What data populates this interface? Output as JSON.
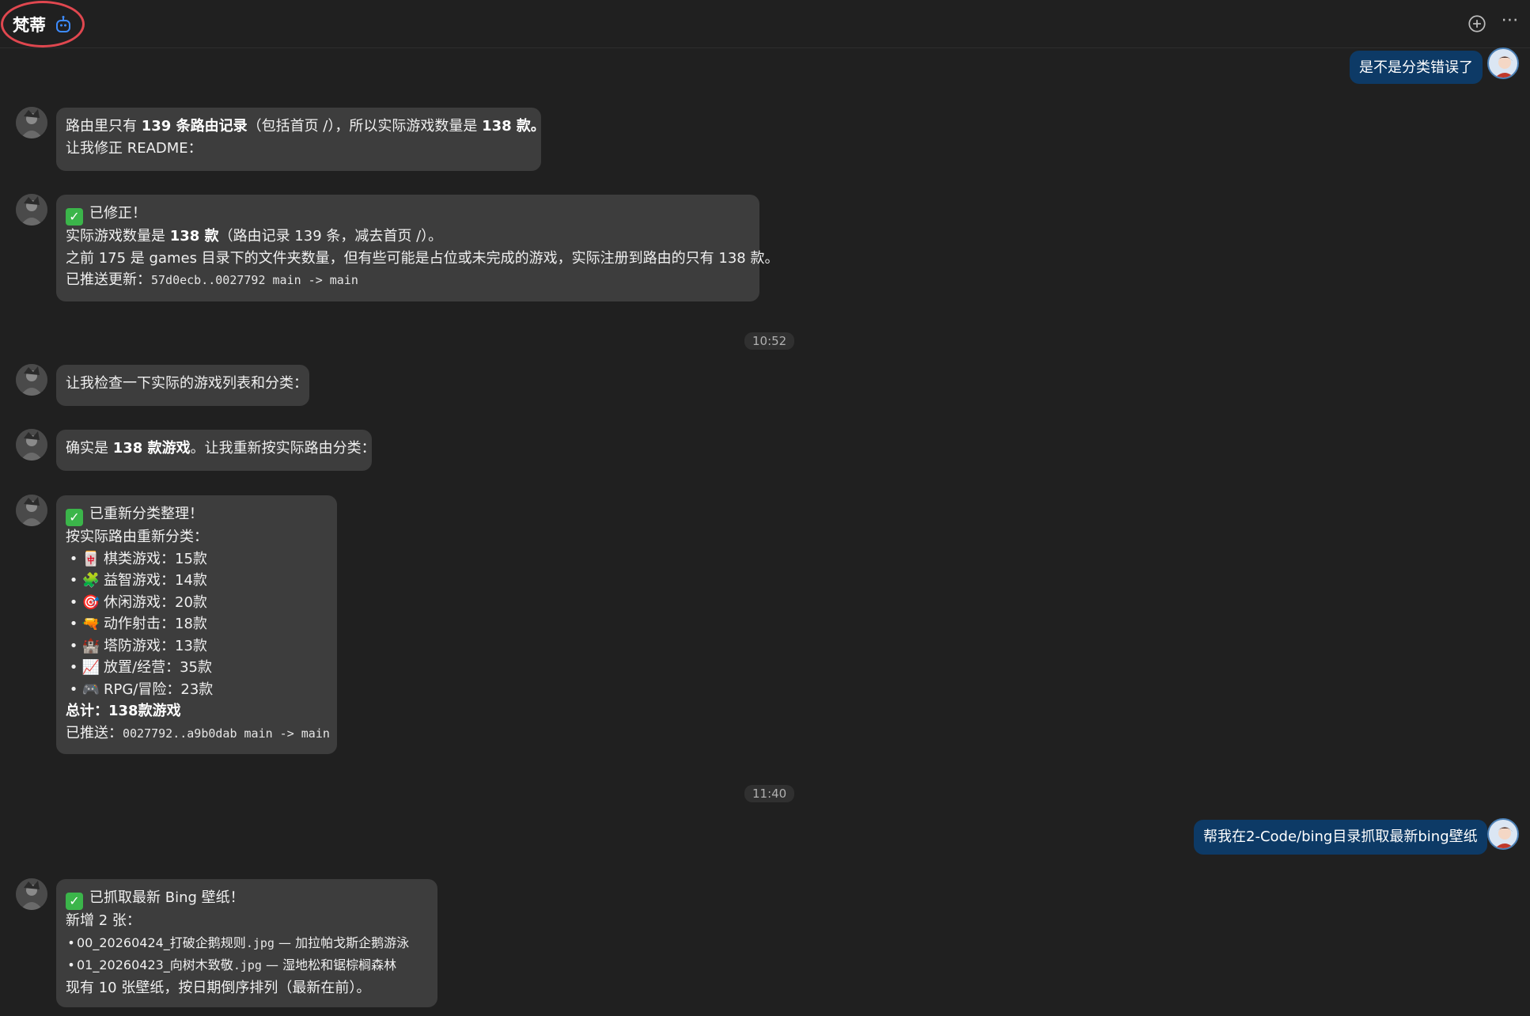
{
  "header": {
    "title": "梵蒂",
    "add_icon": "plus-circle-icon",
    "more_icon": "more-dots-icon",
    "more_label": "⋯"
  },
  "timestamps": {
    "t1": "10:52",
    "t2": "11:40"
  },
  "messages": {
    "u1": {
      "text": "是不是分类错误了"
    },
    "a1": {
      "p1": "路由里只有 ",
      "b1": "139 条路由记录",
      "p2": "（包括首页 /），所以实际游戏数量是 ",
      "b2": "138 款。",
      "line2": "让我修正 README："
    },
    "a2": {
      "title": "已修正！",
      "l2a": "实际游戏数量是 ",
      "l2b": "138 款",
      "l2c": "（路由记录 139 条，减去首页 /）。",
      "l3": "之前 175 是 games 目录下的文件夹数量，但有些可能是占位或未完成的游戏，实际注册到路由的只有 138 款。",
      "l4a": "已推送更新：",
      "l4b": "57d0ecb..0027792 main -> main"
    },
    "a3": {
      "text": "让我检查一下实际的游戏列表和分类："
    },
    "a4": {
      "p1": "确实是 ",
      "b1": "138 款游戏",
      "p2": "。让我重新按实际路由分类："
    },
    "a5": {
      "title": "已重新分类整理！",
      "line2": "按实际路由重新分类：",
      "items": [
        {
          "emoji": "🀄",
          "text": "棋类游戏：15款"
        },
        {
          "emoji": "🧩",
          "text": "益智游戏：14款"
        },
        {
          "emoji": "🎯",
          "text": "休闲游戏：20款"
        },
        {
          "emoji": "🔫",
          "text": "动作射击：18款"
        },
        {
          "emoji": "🏰",
          "text": "塔防游戏：13款"
        },
        {
          "emoji": "📈",
          "text": "放置/经营：35款"
        },
        {
          "emoji": "🎮",
          "text": "RPG/冒险：23款"
        }
      ],
      "total": "总计：138款游戏",
      "pushed_a": "已推送：",
      "pushed_b": "0027792..a9b0dab main -> main"
    },
    "u2": {
      "text": "帮我在2-Code/bing目录抓取最新bing壁纸"
    },
    "a6": {
      "title": "已抓取最新 Bing 壁纸！",
      "line2": "新增 2 张：",
      "i1a": "00_20260424_打破企鹅规则",
      "i1b": ".jpg",
      "i1c": " — 加拉帕戈斯企鹅游泳",
      "i2a": "01_20260423_向树木致敬",
      "i2b": ".jpg",
      "i2c": " — 湿地松和锯棕榈森林",
      "line5": "现有 10 张壁纸，按日期倒序排列（最新在前）。"
    }
  },
  "bullet": "•",
  "check_mark": "✓",
  "colors": {
    "user_bubble": "#0d3a66",
    "assistant_bubble": "#3d3d3d",
    "highlight": "#e0474f",
    "check": "#3bb54a"
  }
}
